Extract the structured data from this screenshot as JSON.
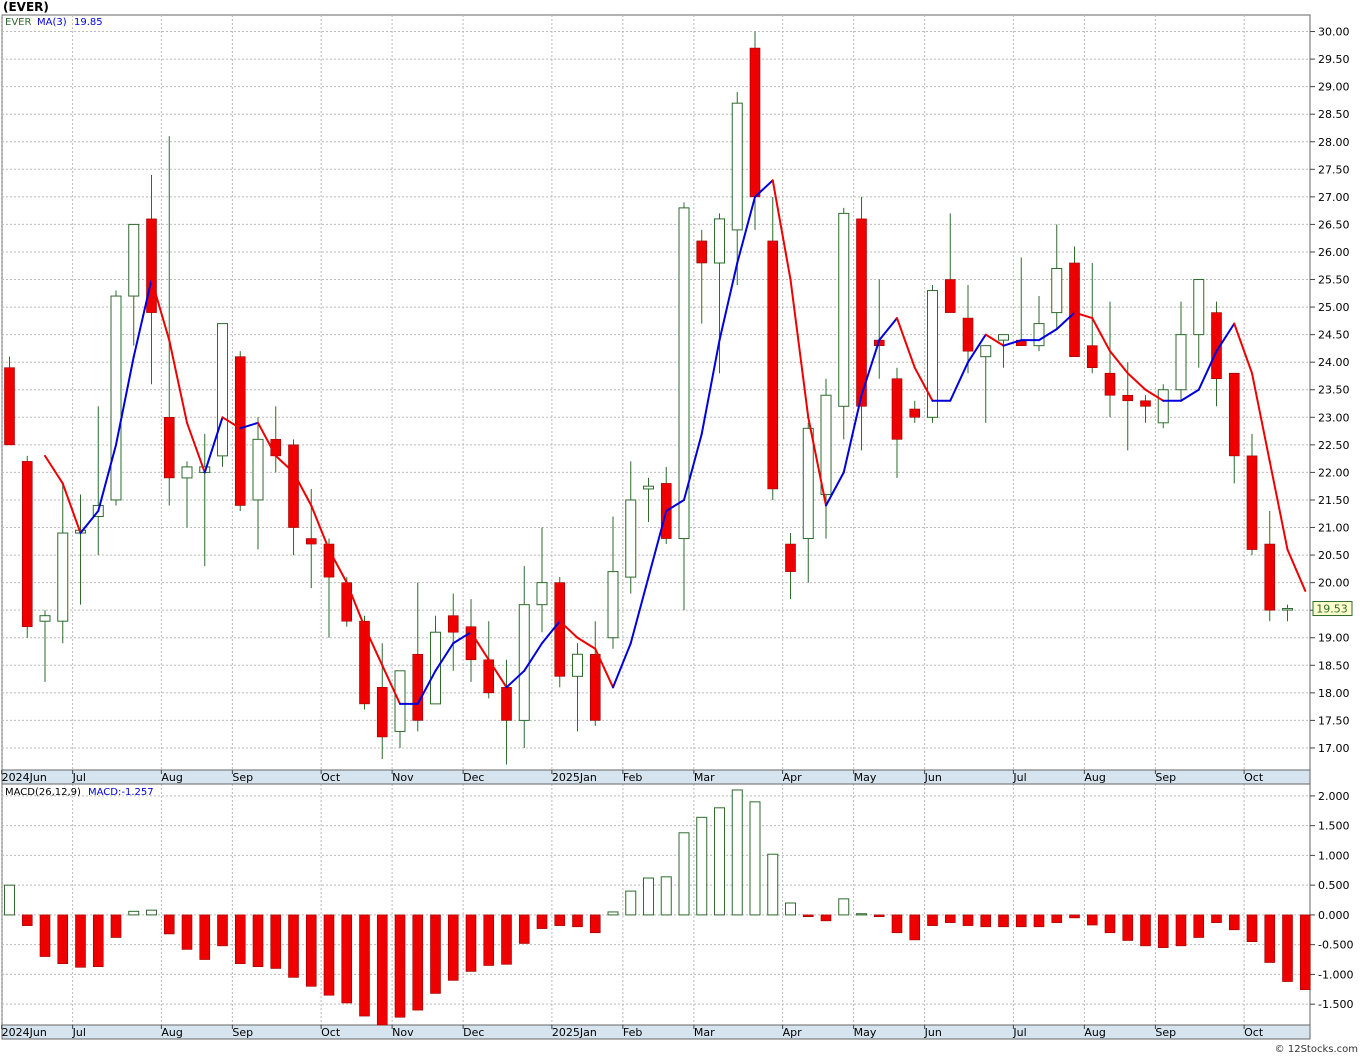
{
  "header": {
    "ticker_title": "(EVER)"
  },
  "price_panel": {
    "legend_symbol": "EVER",
    "legend_ma": "MA(3)",
    "legend_ma_value": "19.85",
    "last_price_label": "19.53"
  },
  "macd_panel": {
    "legend_params": "MACD(26,12,9)",
    "legend_value": "MACD:-1.257"
  },
  "watermark": "© 12Stocks.com",
  "colors": {
    "up_outline": "#2e6b2e",
    "down_fill": "#ee0000",
    "ma_up": "#0000dd",
    "ma_down": "#ee0000",
    "grid": "#bbbbbb",
    "axis_band": "#d6e4f0",
    "last_label_bg": "#ffffcc"
  },
  "chart_data": [
    {
      "type": "candlestick",
      "series": [
        {
          "name": "EVER",
          "interval": "weekly"
        },
        {
          "name": "MA(3)"
        }
      ],
      "yrange": [
        16.6,
        30.3
      ],
      "yticks": [
        17.0,
        17.5,
        18.0,
        18.5,
        19.0,
        19.5,
        20.0,
        20.5,
        21.0,
        21.5,
        22.0,
        22.5,
        23.0,
        23.5,
        24.0,
        24.5,
        25.0,
        25.5,
        26.0,
        26.5,
        27.0,
        27.5,
        28.0,
        28.5,
        29.0,
        29.5,
        30.0
      ],
      "ytick_labels": [
        "17.00",
        "17.50",
        "18.00",
        "18.50",
        "19.00",
        "19.50",
        "20.00",
        "20.50",
        "21.00",
        "21.50",
        "22.00",
        "22.50",
        "23.00",
        "23.50",
        "24.00",
        "24.50",
        "25.00",
        "25.50",
        "26.00",
        "26.50",
        "27.00",
        "27.50",
        "28.00",
        "28.50",
        "29.00",
        "29.50",
        "30.00"
      ],
      "x_labels": [
        {
          "i": 0,
          "label": "2024Jun"
        },
        {
          "i": 4,
          "label": "Jul"
        },
        {
          "i": 9,
          "label": "Aug"
        },
        {
          "i": 13,
          "label": "Sep"
        },
        {
          "i": 18,
          "label": "Oct"
        },
        {
          "i": 22,
          "label": "Nov"
        },
        {
          "i": 26,
          "label": "Dec"
        },
        {
          "i": 31,
          "label": "2025Jan"
        },
        {
          "i": 35,
          "label": "Feb"
        },
        {
          "i": 39,
          "label": "Mar"
        },
        {
          "i": 44,
          "label": "Apr"
        },
        {
          "i": 48,
          "label": "May"
        },
        {
          "i": 52,
          "label": "Jun"
        },
        {
          "i": 57,
          "label": "Jul"
        },
        {
          "i": 61,
          "label": "Aug"
        },
        {
          "i": 65,
          "label": "Sep"
        },
        {
          "i": 70,
          "label": "Oct"
        }
      ],
      "candles": [
        {
          "o": 23.9,
          "h": 24.1,
          "l": 22.8,
          "c": 22.5
        },
        {
          "o": 22.2,
          "h": 22.3,
          "l": 19.0,
          "c": 19.2
        },
        {
          "o": 19.3,
          "h": 19.5,
          "l": 18.2,
          "c": 19.4
        },
        {
          "o": 19.3,
          "h": 21.8,
          "l": 18.9,
          "c": 20.9
        },
        {
          "o": 20.9,
          "h": 21.6,
          "l": 19.6,
          "c": 20.95
        },
        {
          "o": 21.2,
          "h": 23.2,
          "l": 20.5,
          "c": 21.4
        },
        {
          "o": 21.5,
          "h": 25.3,
          "l": 21.4,
          "c": 25.2
        },
        {
          "o": 25.2,
          "h": 26.5,
          "l": 24.3,
          "c": 26.5
        },
        {
          "o": 26.6,
          "h": 27.4,
          "l": 23.6,
          "c": 24.9
        },
        {
          "o": 23.0,
          "h": 28.1,
          "l": 21.4,
          "c": 21.9
        },
        {
          "o": 21.9,
          "h": 22.2,
          "l": 21.0,
          "c": 22.1
        },
        {
          "o": 22.0,
          "h": 22.7,
          "l": 20.3,
          "c": 22.1
        },
        {
          "o": 22.3,
          "h": 24.7,
          "l": 22.1,
          "c": 24.7
        },
        {
          "o": 24.1,
          "h": 24.2,
          "l": 21.3,
          "c": 21.4
        },
        {
          "o": 21.5,
          "h": 23.0,
          "l": 20.6,
          "c": 22.6
        },
        {
          "o": 22.6,
          "h": 23.2,
          "l": 22.0,
          "c": 22.3
        },
        {
          "o": 22.5,
          "h": 22.6,
          "l": 20.5,
          "c": 21.0
        },
        {
          "o": 20.8,
          "h": 21.7,
          "l": 19.9,
          "c": 20.7
        },
        {
          "o": 20.7,
          "h": 20.8,
          "l": 19.0,
          "c": 20.1
        },
        {
          "o": 20.0,
          "h": 20.1,
          "l": 19.2,
          "c": 19.3
        },
        {
          "o": 19.3,
          "h": 19.4,
          "l": 17.7,
          "c": 17.8
        },
        {
          "o": 18.1,
          "h": 18.9,
          "l": 16.8,
          "c": 17.2
        },
        {
          "o": 17.3,
          "h": 18.4,
          "l": 17.0,
          "c": 18.4
        },
        {
          "o": 18.7,
          "h": 20.0,
          "l": 17.3,
          "c": 17.5
        },
        {
          "o": 17.8,
          "h": 19.4,
          "l": 17.8,
          "c": 19.1
        },
        {
          "o": 19.4,
          "h": 19.8,
          "l": 18.4,
          "c": 19.1
        },
        {
          "o": 19.2,
          "h": 19.7,
          "l": 18.2,
          "c": 18.6
        },
        {
          "o": 18.6,
          "h": 19.3,
          "l": 17.9,
          "c": 18.0
        },
        {
          "o": 18.1,
          "h": 18.6,
          "l": 16.7,
          "c": 17.5
        },
        {
          "o": 17.5,
          "h": 20.3,
          "l": 17.0,
          "c": 19.6
        },
        {
          "o": 19.6,
          "h": 21.0,
          "l": 19.1,
          "c": 20.0
        },
        {
          "o": 20.0,
          "h": 20.1,
          "l": 18.1,
          "c": 18.3
        },
        {
          "o": 18.3,
          "h": 18.9,
          "l": 17.3,
          "c": 18.7
        },
        {
          "o": 18.7,
          "h": 19.3,
          "l": 17.4,
          "c": 17.5
        },
        {
          "o": 19.0,
          "h": 21.2,
          "l": 18.8,
          "c": 20.2
        },
        {
          "o": 20.1,
          "h": 22.2,
          "l": 19.8,
          "c": 21.5
        },
        {
          "o": 21.7,
          "h": 21.9,
          "l": 21.1,
          "c": 21.75
        },
        {
          "o": 21.8,
          "h": 22.1,
          "l": 20.7,
          "c": 20.8
        },
        {
          "o": 20.8,
          "h": 26.9,
          "l": 19.5,
          "c": 26.8
        },
        {
          "o": 26.2,
          "h": 26.4,
          "l": 24.7,
          "c": 25.8
        },
        {
          "o": 25.8,
          "h": 26.7,
          "l": 23.8,
          "c": 26.6
        },
        {
          "o": 26.4,
          "h": 28.9,
          "l": 25.4,
          "c": 28.7
        },
        {
          "o": 29.7,
          "h": 30.0,
          "l": 26.4,
          "c": 27.0
        },
        {
          "o": 26.2,
          "h": 27.0,
          "l": 21.5,
          "c": 21.7
        },
        {
          "o": 20.7,
          "h": 20.9,
          "l": 19.7,
          "c": 20.2
        },
        {
          "o": 20.8,
          "h": 22.9,
          "l": 20.0,
          "c": 22.8
        },
        {
          "o": 21.6,
          "h": 23.7,
          "l": 20.8,
          "c": 23.4
        },
        {
          "o": 23.2,
          "h": 26.8,
          "l": 22.6,
          "c": 26.7
        },
        {
          "o": 26.6,
          "h": 27.0,
          "l": 22.4,
          "c": 23.2
        },
        {
          "o": 24.4,
          "h": 25.5,
          "l": 23.7,
          "c": 24.3
        },
        {
          "o": 23.7,
          "h": 23.9,
          "l": 21.9,
          "c": 22.6
        },
        {
          "o": 23.15,
          "h": 23.3,
          "l": 22.9,
          "c": 23.0
        },
        {
          "o": 23.0,
          "h": 25.4,
          "l": 22.9,
          "c": 25.3
        },
        {
          "o": 25.5,
          "h": 26.7,
          "l": 24.9,
          "c": 24.9
        },
        {
          "o": 24.8,
          "h": 25.4,
          "l": 23.8,
          "c": 24.2
        },
        {
          "o": 24.1,
          "h": 24.3,
          "l": 22.9,
          "c": 24.3
        },
        {
          "o": 24.4,
          "h": 24.5,
          "l": 23.9,
          "c": 24.5
        },
        {
          "o": 24.4,
          "h": 25.9,
          "l": 24.3,
          "c": 24.3
        },
        {
          "o": 24.3,
          "h": 25.2,
          "l": 24.2,
          "c": 24.7
        },
        {
          "o": 24.9,
          "h": 26.5,
          "l": 24.6,
          "c": 25.7
        },
        {
          "o": 25.8,
          "h": 26.1,
          "l": 24.1,
          "c": 24.1
        },
        {
          "o": 24.3,
          "h": 25.8,
          "l": 23.8,
          "c": 23.9
        },
        {
          "o": 23.8,
          "h": 25.1,
          "l": 23.0,
          "c": 23.4
        },
        {
          "o": 23.4,
          "h": 24.0,
          "l": 22.4,
          "c": 23.3
        },
        {
          "o": 23.3,
          "h": 23.4,
          "l": 22.9,
          "c": 23.2
        },
        {
          "o": 22.9,
          "h": 23.6,
          "l": 22.8,
          "c": 23.5
        },
        {
          "o": 23.5,
          "h": 25.1,
          "l": 23.3,
          "c": 24.5
        },
        {
          "o": 24.5,
          "h": 25.5,
          "l": 23.9,
          "c": 25.5
        },
        {
          "o": 24.9,
          "h": 25.1,
          "l": 23.2,
          "c": 23.7
        },
        {
          "o": 23.8,
          "h": 23.8,
          "l": 21.8,
          "c": 22.3
        },
        {
          "o": 22.3,
          "h": 22.7,
          "l": 20.5,
          "c": 20.6
        },
        {
          "o": 20.7,
          "h": 21.3,
          "l": 19.3,
          "c": 19.5
        },
        {
          "o": 19.53,
          "h": 19.6,
          "l": 19.3,
          "c": 19.53
        }
      ],
      "ma": [
        null,
        null,
        22.3,
        21.8,
        20.9,
        21.3,
        22.5,
        24.1,
        25.5,
        24.4,
        22.9,
        22.0,
        23.0,
        22.8,
        22.9,
        22.3,
        22.0,
        21.4,
        20.6,
        20.0,
        19.2,
        18.5,
        17.8,
        17.8,
        18.4,
        18.9,
        19.1,
        18.6,
        18.1,
        18.4,
        18.9,
        19.3,
        19.0,
        18.8,
        18.1,
        18.9,
        20.1,
        21.3,
        21.5,
        22.7,
        24.4,
        25.8,
        27.0,
        27.3,
        25.5,
        23.0,
        21.4,
        22.0,
        23.4,
        24.4,
        24.8,
        23.9,
        23.3,
        23.3,
        24.0,
        24.5,
        24.3,
        24.4,
        24.4,
        24.6,
        24.9,
        24.8,
        24.2,
        23.8,
        23.5,
        23.3,
        23.3,
        23.5,
        24.2,
        24.7,
        23.8,
        22.2,
        20.6,
        19.85
      ]
    },
    {
      "type": "bar",
      "series": [
        {
          "name": "MACD(26,12,9)"
        }
      ],
      "yrange": [
        -1.85,
        2.2
      ],
      "yticks": [
        -1.5,
        -1.0,
        -0.5,
        0.0,
        0.5,
        1.0,
        1.5,
        2.0
      ],
      "ytick_labels": [
        "-1.500",
        "-1.000",
        "-0.500",
        "0.000",
        "0.500",
        "1.000",
        "1.500",
        "2.000"
      ],
      "x_labels": [
        {
          "i": 0,
          "label": "2024Jun"
        },
        {
          "i": 4,
          "label": "Jul"
        },
        {
          "i": 9,
          "label": "Aug"
        },
        {
          "i": 13,
          "label": "Sep"
        },
        {
          "i": 18,
          "label": "Oct"
        },
        {
          "i": 22,
          "label": "Nov"
        },
        {
          "i": 26,
          "label": "Dec"
        },
        {
          "i": 31,
          "label": "2025Jan"
        },
        {
          "i": 35,
          "label": "Feb"
        },
        {
          "i": 39,
          "label": "Mar"
        },
        {
          "i": 44,
          "label": "Apr"
        },
        {
          "i": 48,
          "label": "May"
        },
        {
          "i": 52,
          "label": "Jun"
        },
        {
          "i": 57,
          "label": "Jul"
        },
        {
          "i": 61,
          "label": "Aug"
        },
        {
          "i": 65,
          "label": "Sep"
        },
        {
          "i": 70,
          "label": "Oct"
        }
      ],
      "values": [
        0.5,
        -0.18,
        -0.7,
        -0.82,
        -0.88,
        -0.87,
        -0.38,
        0.06,
        0.08,
        -0.32,
        -0.58,
        -0.75,
        -0.52,
        -0.82,
        -0.87,
        -0.9,
        -1.05,
        -1.2,
        -1.35,
        -1.48,
        -1.7,
        -1.85,
        -1.72,
        -1.6,
        -1.32,
        -1.1,
        -0.95,
        -0.85,
        -0.83,
        -0.48,
        -0.23,
        -0.18,
        -0.2,
        -0.3,
        0.05,
        0.4,
        0.62,
        0.64,
        1.38,
        1.64,
        1.8,
        2.1,
        1.9,
        1.02,
        0.2,
        -0.03,
        -0.1,
        0.27,
        0.02,
        -0.03,
        -0.3,
        -0.42,
        -0.18,
        -0.13,
        -0.18,
        -0.2,
        -0.2,
        -0.2,
        -0.2,
        -0.13,
        -0.05,
        -0.17,
        -0.3,
        -0.43,
        -0.52,
        -0.55,
        -0.52,
        -0.38,
        -0.13,
        -0.25,
        -0.45,
        -0.8,
        -1.12,
        -1.257
      ]
    }
  ]
}
